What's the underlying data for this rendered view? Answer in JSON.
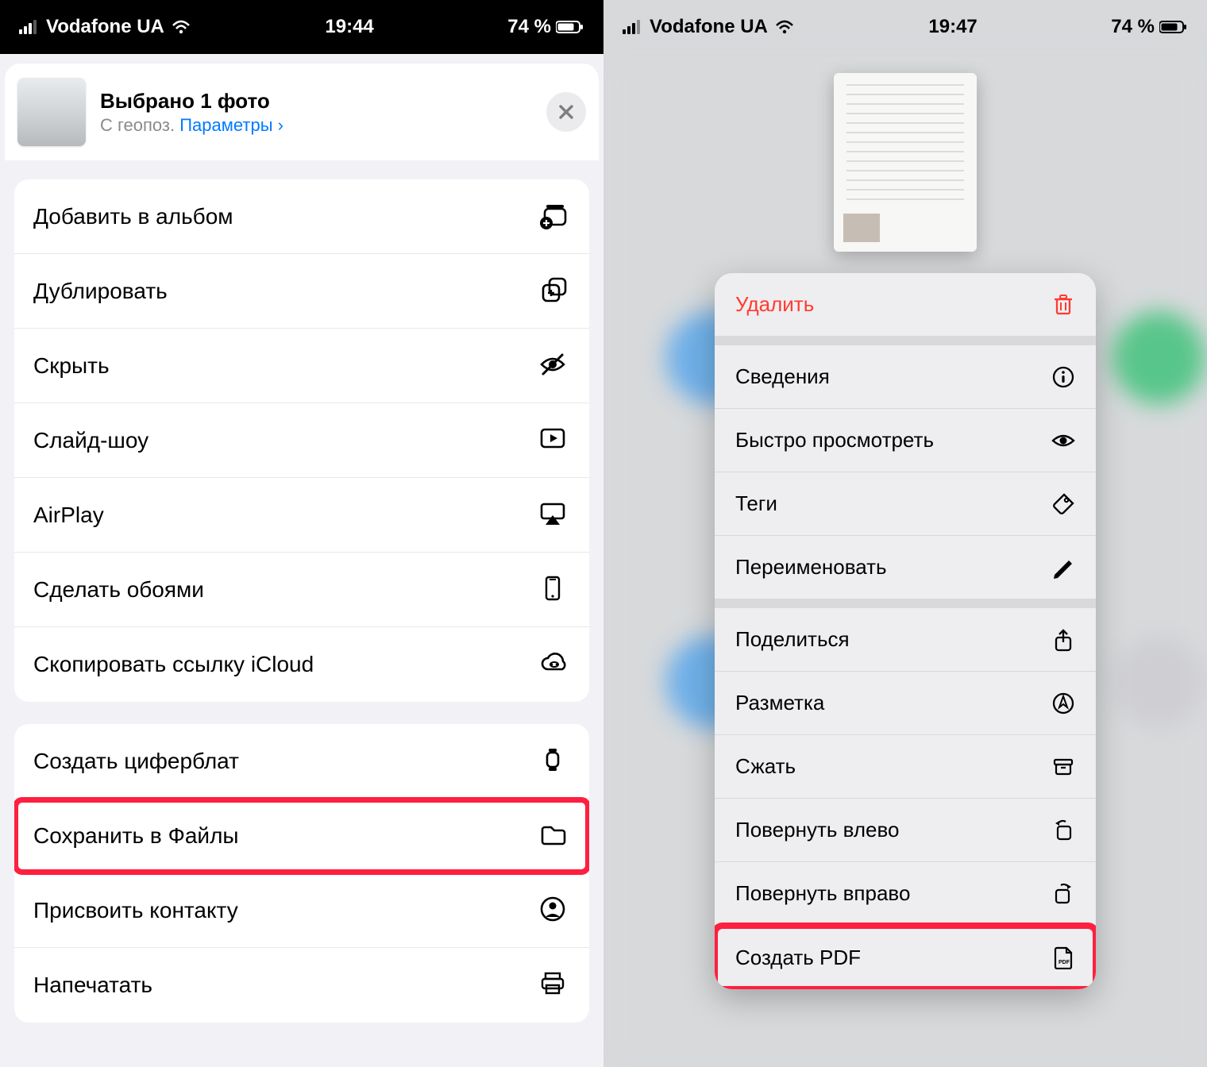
{
  "left": {
    "status": {
      "carrier": "Vodafone UA",
      "time": "19:44",
      "battery_pct": "74 %"
    },
    "sheet": {
      "title": "Выбрано 1 фото",
      "sub_prefix": "С геопоз.  ",
      "options_link": "Параметры ",
      "chevron": "›"
    },
    "group1": [
      {
        "label": "Добавить в альбом",
        "icon": "add-album-icon"
      },
      {
        "label": "Дублировать",
        "icon": "duplicate-icon"
      },
      {
        "label": "Скрыть",
        "icon": "hide-eye-icon"
      },
      {
        "label": "Слайд-шоу",
        "icon": "slideshow-icon"
      },
      {
        "label": "AirPlay",
        "icon": "airplay-icon"
      },
      {
        "label": "Сделать обоями",
        "icon": "phone-wallpaper-icon"
      },
      {
        "label": "Скопировать ссылку iCloud",
        "icon": "icloud-link-icon"
      }
    ],
    "group2": [
      {
        "label": "Создать циферблат",
        "icon": "watch-face-icon",
        "highlight": false
      },
      {
        "label": "Сохранить в Файлы",
        "icon": "folder-icon",
        "highlight": true
      },
      {
        "label": "Присвоить контакту",
        "icon": "contact-icon",
        "highlight": false
      },
      {
        "label": "Напечатать",
        "icon": "print-icon",
        "highlight": false
      }
    ]
  },
  "right": {
    "status": {
      "carrier": "Vodafone UA",
      "time": "19:47",
      "battery_pct": "74 %"
    },
    "menu": [
      {
        "label": "Удалить",
        "icon": "trash-icon",
        "danger": true,
        "sep_after": true
      },
      {
        "label": "Сведения",
        "icon": "info-icon"
      },
      {
        "label": "Быстро просмотреть",
        "icon": "eye-icon"
      },
      {
        "label": "Теги",
        "icon": "tag-icon"
      },
      {
        "label": "Переименовать",
        "icon": "pencil-icon",
        "sep_after": true
      },
      {
        "label": "Поделиться",
        "icon": "share-icon"
      },
      {
        "label": "Разметка",
        "icon": "markup-icon"
      },
      {
        "label": "Сжать",
        "icon": "archive-icon"
      },
      {
        "label": "Повернуть влево",
        "icon": "rotate-left-icon"
      },
      {
        "label": "Повернуть вправо",
        "icon": "rotate-right-icon"
      },
      {
        "label": "Создать PDF",
        "icon": "pdf-icon",
        "highlight": true
      }
    ]
  }
}
